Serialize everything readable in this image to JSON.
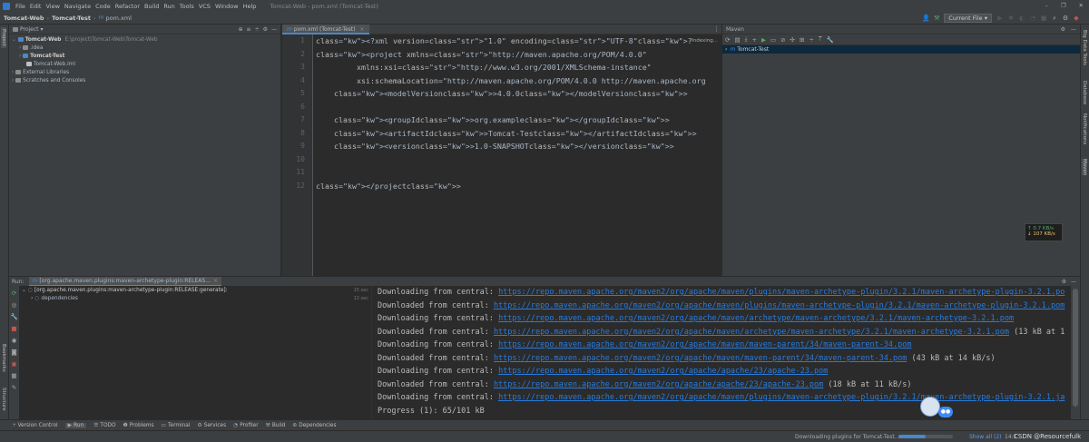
{
  "menubar": {
    "app_icon": "intellij-logo-icon",
    "items": [
      "File",
      "Edit",
      "View",
      "Navigate",
      "Code",
      "Refactor",
      "Build",
      "Run",
      "Tools",
      "VCS",
      "Window",
      "Help"
    ],
    "window_title": "Tomcat-Web - pom.xml (Tomcat-Test)"
  },
  "navbar": {
    "crumbs": [
      "Tomcat-Web",
      "Tomcat-Test",
      "pom.xml"
    ],
    "run_config": "Current File"
  },
  "left_strip": {
    "project_label": "Project",
    "bookmarks_label": "Bookmarks",
    "structure_label": "Structure"
  },
  "right_strip": {
    "big_data": "Big Data Tools",
    "database": "Database",
    "notifications": "Notifications",
    "maven": "Maven"
  },
  "project_panel": {
    "title": "Project",
    "tree": [
      {
        "label": "Tomcat-Web",
        "path": "E:\\project\\Tomcat-Web\\Tomcat-Web",
        "indent": 0,
        "arrow": "v",
        "bold": true
      },
      {
        "label": ".idea",
        "indent": 1,
        "arrow": ">"
      },
      {
        "label": "Tomcat-Test",
        "indent": 1,
        "arrow": ">",
        "bold": true
      },
      {
        "label": "Tomcat-Web.iml",
        "indent": 2,
        "arrow": ""
      },
      {
        "label": "External Libraries",
        "indent": 0,
        "arrow": ">"
      },
      {
        "label": "Scratches and Consoles",
        "indent": 0,
        "arrow": ">"
      }
    ]
  },
  "editor": {
    "tab_label": "pom.xml (Tomcat-Test)",
    "indexing": "Indexing...",
    "line_numbers": [
      "1",
      "2",
      "3",
      "4",
      "5",
      "6",
      "7",
      "8",
      "9",
      "10",
      "11",
      "12"
    ],
    "lines": [
      "<?xml version=\"1.0\" encoding=\"UTF-8\"?>",
      "<project xmlns=\"http://maven.apache.org/POM/4.0.0\"",
      "         xmlns:xsi=\"http://www.w3.org/2001/XMLSchema-instance\"",
      "         xsi:schemaLocation=\"http://maven.apache.org/POM/4.0.0 http://maven.apache.org",
      "    <modelVersion>4.0.0</modelVersion>",
      "",
      "    <groupId>org.example</groupId>",
      "    <artifactId>Tomcat-Test</artifactId>",
      "    <version>1.0-SNAPSHOT</version>",
      "",
      "",
      "</project>"
    ]
  },
  "maven_panel": {
    "title": "Maven",
    "tree_item": "Tomcat-Test"
  },
  "network": {
    "up": "↑ 0.7 KB/s",
    "down": "↓ 107 KB/s"
  },
  "run_panel": {
    "label": "Run:",
    "tab": "[org.apache.maven.plugins:maven-archetype-plugin:RELEAS...",
    "tree": [
      {
        "label": "[org.apache.maven.plugins:maven-archetype-plugin:RELEASE:generate]:",
        "time": "15 sec"
      },
      {
        "label": "dependencies",
        "time": "12 sec"
      }
    ],
    "console": [
      {
        "prefix": "Downloading from central: ",
        "url": "https://repo.maven.apache.org/maven2/org/apache/maven/plugins/maven-archetype-plugin/3.2.1/maven-archetype-plugin-3.2.1.po",
        "suffix": ""
      },
      {
        "prefix": "Downloaded from central: ",
        "url": "https://repo.maven.apache.org/maven2/org/apache/maven/plugins/maven-archetype-plugin/3.2.1/maven-archetype-plugin-3.2.1.pom",
        "suffix": ""
      },
      {
        "prefix": "Downloading from central: ",
        "url": "https://repo.maven.apache.org/maven2/org/apache/maven/archetype/maven-archetype/3.2.1/maven-archetype-3.2.1.pom",
        "suffix": ""
      },
      {
        "prefix": "Downloaded from central: ",
        "url": "https://repo.maven.apache.org/maven2/org/apache/maven/archetype/maven-archetype/3.2.1/maven-archetype-3.2.1.pom",
        "suffix": " (13 kB at 1"
      },
      {
        "prefix": "Downloading from central: ",
        "url": "https://repo.maven.apache.org/maven2/org/apache/maven/maven-parent/34/maven-parent-34.pom",
        "suffix": ""
      },
      {
        "prefix": "Downloaded from central: ",
        "url": "https://repo.maven.apache.org/maven2/org/apache/maven/maven-parent/34/maven-parent-34.pom",
        "suffix": " (43 kB at 14 kB/s)"
      },
      {
        "prefix": "Downloading from central: ",
        "url": "https://repo.maven.apache.org/maven2/org/apache/apache/23/apache-23.pom",
        "suffix": ""
      },
      {
        "prefix": "Downloaded from central: ",
        "url": "https://repo.maven.apache.org/maven2/org/apache/apache/23/apache-23.pom",
        "suffix": " (18 kB at 11 kB/s)"
      },
      {
        "prefix": "Downloading from central: ",
        "url": "https://repo.maven.apache.org/maven2/org/apache/maven/plugins/maven-archetype-plugin/3.2.1/maven-archetype-plugin-3.2.1.ja",
        "suffix": ""
      }
    ],
    "progress": "Progress (1): 65/101 kB"
  },
  "tool_windows": [
    "Version Control",
    "Run",
    "TODO",
    "Problems",
    "Terminal",
    "Services",
    "Profiler",
    "Build",
    "Dependencies"
  ],
  "status": {
    "task": "Downloading plugins for Tomcat-Test...",
    "show_all": "Show all (2)",
    "position": "14:1",
    "watermark": "CSDN @Resourcefulk"
  },
  "colors": {
    "accent": "#4a88c7",
    "link": "#287bde",
    "tag": "#e8bf6a",
    "string": "#6a8759"
  }
}
